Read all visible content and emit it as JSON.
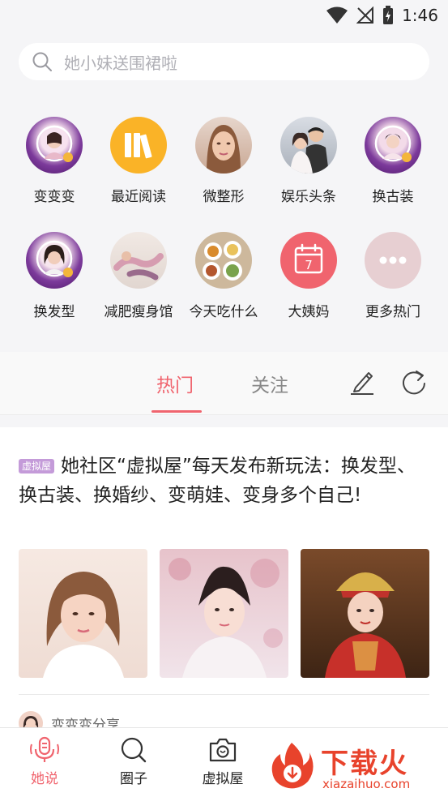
{
  "status_bar": {
    "time": "1:46"
  },
  "search": {
    "placeholder": "她小妹送围裙啦"
  },
  "features": [
    {
      "label": "变变变",
      "icon": "avatar-frame-icon"
    },
    {
      "label": "最近阅读",
      "icon": "books-icon"
    },
    {
      "label": "微整形",
      "icon": "face-portrait-icon"
    },
    {
      "label": "娱乐头条",
      "icon": "celebrity-photo-icon"
    },
    {
      "label": "换古装",
      "icon": "costume-portrait-icon"
    },
    {
      "label": "换发型",
      "icon": "hairstyle-portrait-icon"
    },
    {
      "label": "减肥瘦身馆",
      "icon": "fitness-photo-icon"
    },
    {
      "label": "今天吃什么",
      "icon": "food-photo-icon"
    },
    {
      "label": "大姨妈",
      "icon": "calendar-icon",
      "calendar_day": "7"
    },
    {
      "label": "更多热门",
      "icon": "more-dots-icon"
    }
  ],
  "tabs": {
    "hot": "热门",
    "follow": "关注"
  },
  "post": {
    "tag": "虚拟屋",
    "title": "她社区“虚拟屋”每天发布新玩法：换发型、换古装、换婚纱、变萌娃、变身多个自己!",
    "images": [
      "bob-hair-portrait",
      "ancient-costume-portrait",
      "wedding-costume-child-portrait"
    ]
  },
  "next_post": {
    "author": "变变变分享"
  },
  "bottom_nav": [
    {
      "label": "她说",
      "icon": "microphone-icon",
      "active": true
    },
    {
      "label": "圈子",
      "icon": "search-icon",
      "active": false
    },
    {
      "label": "虚拟屋",
      "icon": "camera-icon",
      "active": false
    }
  ],
  "watermark": {
    "text": "下载火",
    "url": "xiazaihuo.com"
  },
  "colors": {
    "accent": "#f0646e",
    "background": "#f5f5f7",
    "tag": "#c49bd9"
  }
}
